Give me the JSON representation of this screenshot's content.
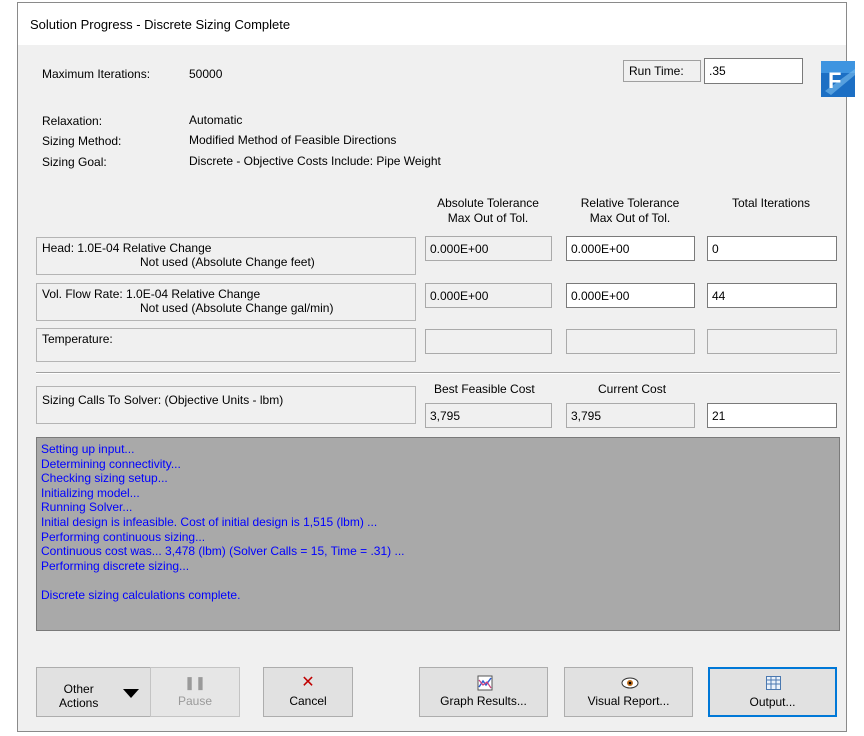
{
  "window": {
    "title": "Solution Progress - Discrete Sizing Complete"
  },
  "info": {
    "max_iterations_label": "Maximum Iterations:",
    "max_iterations_value": "50000",
    "run_time_label": "Run Time:",
    "run_time_value": ".35",
    "relaxation_label": "Relaxation:",
    "relaxation_value": "Automatic",
    "sizing_method_label": "Sizing Method:",
    "sizing_method_value": "Modified Method of Feasible Directions",
    "sizing_goal_label": "Sizing Goal:",
    "sizing_goal_value": "Discrete - Objective Costs Include: Pipe Weight"
  },
  "tolerance": {
    "headers": {
      "abs_line1": "Absolute Tolerance",
      "abs_line2": "Max Out of Tol.",
      "rel_line1": "Relative Tolerance",
      "rel_line2": "Max Out of Tol.",
      "total": "Total Iterations"
    },
    "rows": [
      {
        "line1": "Head: 1.0E-04 Relative Change",
        "line2": "Not used (Absolute Change feet)",
        "abs": "0.000E+00",
        "rel": "0.000E+00",
        "total": "0"
      },
      {
        "line1": "Vol. Flow Rate: 1.0E-04 Relative Change",
        "line2": "Not used (Absolute Change gal/min)",
        "abs": "0.000E+00",
        "rel": "0.000E+00",
        "total": "44"
      },
      {
        "line1": "Temperature:",
        "line2": "",
        "abs": "",
        "rel": "",
        "total": ""
      }
    ]
  },
  "sizing": {
    "label": "Sizing Calls To Solver: (Objective Units - lbm)",
    "best_header": "Best Feasible Cost",
    "current_header": "Current Cost",
    "best_value": "3,795",
    "current_value": "3,795",
    "calls_value": "21"
  },
  "log": {
    "lines": [
      "Setting up input...",
      "Determining connectivity...",
      "Checking sizing setup...",
      "Initializing model...",
      "Running Solver...",
      "Initial design is infeasible. Cost of initial design is 1,515 (lbm) ...",
      "Performing continuous sizing...",
      "Continuous cost was... 3,478 (lbm)  (Solver Calls = 15, Time = .31) ...",
      "Performing discrete sizing...",
      "",
      "Discrete sizing calculations complete."
    ],
    "text_color": "#0000ff",
    "background": "#a9a9a9"
  },
  "buttons": {
    "other_actions_line1": "Other",
    "other_actions_line2": "Actions",
    "pause": "Pause",
    "cancel": "Cancel",
    "graph_results": "Graph Results...",
    "visual_report": "Visual Report...",
    "output": "Output..."
  },
  "icons": {
    "logo": "fathom-logo-icon",
    "pause": "pause-icon",
    "cancel": "x-icon",
    "graph": "graph-icon",
    "visual": "eye-icon",
    "output": "table-icon",
    "dropdown": "triangle-down-icon"
  },
  "colors": {
    "accent": "#0078d7",
    "cancel_icon": "#c00000"
  }
}
